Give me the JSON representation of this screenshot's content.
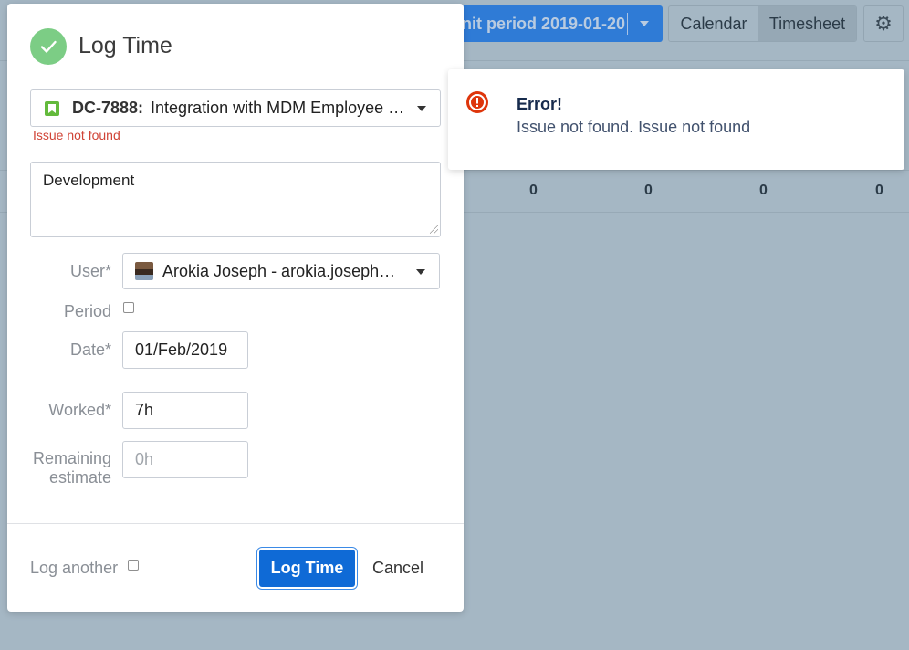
{
  "background": {
    "submit_button_label": "nit period 2019-01-20",
    "view_tabs": [
      {
        "label": "Calendar",
        "active": false
      },
      {
        "label": "Timesheet",
        "active": true
      }
    ],
    "settings_icon": "gear-icon",
    "totals": [
      "0",
      "0",
      "0",
      "0"
    ]
  },
  "modal": {
    "title": "Log Time",
    "header_icon": "check-icon",
    "issue": {
      "key": "DC-7888:",
      "summary": "Integration with MDM Employee Data",
      "error": "Issue not found"
    },
    "description_value": "Development",
    "user": {
      "label": "User*",
      "value": "Arokia Joseph - arokia.joseph@company.com"
    },
    "period": {
      "label": "Period",
      "checked": false
    },
    "date": {
      "label": "Date*",
      "value": "01/Feb/2019"
    },
    "worked": {
      "label": "Worked*",
      "value": "7h"
    },
    "remaining": {
      "label_line1": "Remaining",
      "label_line2": "estimate",
      "placeholder": "0h"
    },
    "footer": {
      "log_another_label": "Log another",
      "log_another_checked": false,
      "submit_label": "Log Time",
      "cancel_label": "Cancel"
    }
  },
  "toast": {
    "title": "Error!",
    "message": "Issue not found. Issue not found",
    "icon": "error-icon"
  },
  "colors": {
    "primary": "#0f6ad6",
    "success": "#7ccd85",
    "error": "#de350b",
    "error_text": "#d04437",
    "overlay": "#a5b7c4"
  }
}
